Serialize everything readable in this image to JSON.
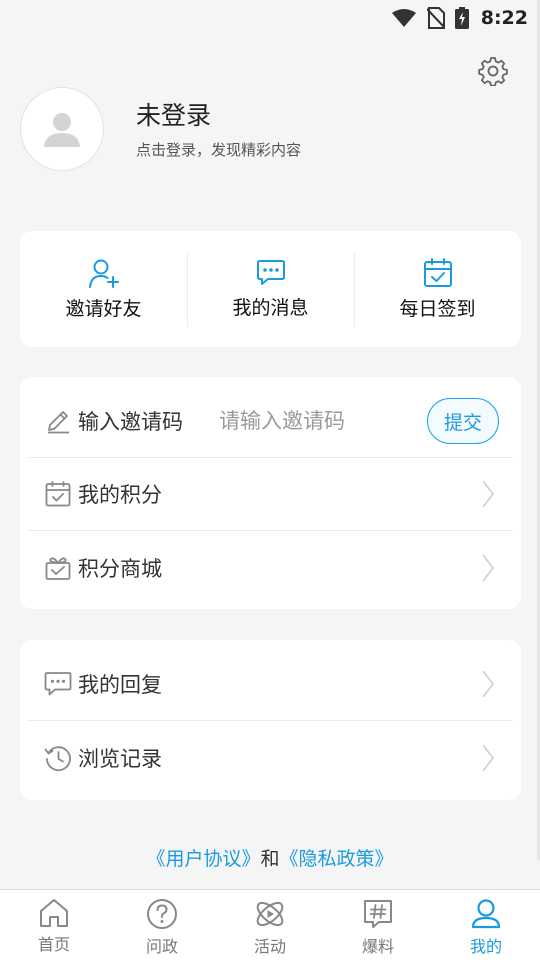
{
  "status_bar": {
    "time": "8:22"
  },
  "profile": {
    "name": "未登录",
    "hint": "点击登录，发现精彩内容"
  },
  "quick_actions": [
    {
      "label": "邀请好友",
      "icon": "add-user-icon"
    },
    {
      "label": "我的消息",
      "icon": "chat-icon"
    },
    {
      "label": "每日签到",
      "icon": "calendar-check-icon"
    }
  ],
  "invite": {
    "label": "输入邀请码",
    "placeholder": "请输入邀请码",
    "value": "",
    "submit_label": "提交"
  },
  "menu_1": [
    {
      "label": "我的积分",
      "icon": "calendar-check-icon"
    },
    {
      "label": "积分商城",
      "icon": "gift-icon"
    }
  ],
  "menu_2": [
    {
      "label": "我的回复",
      "icon": "comment-icon"
    },
    {
      "label": "浏览记录",
      "icon": "history-icon"
    }
  ],
  "agreement": {
    "user_agreement": "《用户协议》",
    "and": "和",
    "privacy_policy": "《隐私政策》"
  },
  "tabbar": {
    "active": "我的",
    "items": [
      {
        "label": "首页",
        "icon": "home-icon"
      },
      {
        "label": "问政",
        "icon": "question-icon"
      },
      {
        "label": "活动",
        "icon": "activity-icon"
      },
      {
        "label": "爆料",
        "icon": "hashtag-icon"
      },
      {
        "label": "我的",
        "icon": "profile-icon"
      }
    ]
  },
  "colors": {
    "accent": "#1a9be0",
    "background": "#f5f5f5",
    "card": "#ffffff"
  }
}
